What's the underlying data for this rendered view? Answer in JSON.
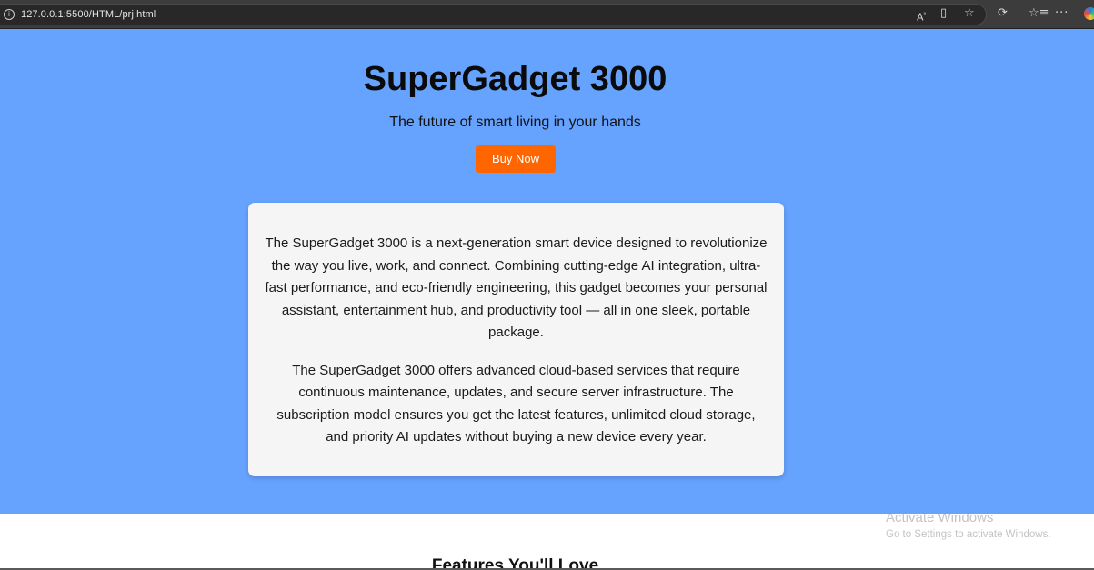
{
  "browser": {
    "url": "127.0.0.1:5500/HTML/prj.html",
    "icons": {
      "site_info": "info-icon",
      "read_aloud": "read-aloud-icon",
      "immersive_reader": "immersive-reader-icon",
      "favorite": "star-icon",
      "extensions": "extensions-icon",
      "favorites": "favorites-icon",
      "more": "more-icon",
      "copilot": "copilot-icon"
    }
  },
  "hero": {
    "title": "SuperGadget 3000",
    "subtitle": "The future of smart living in your hands",
    "buy_label": "Buy Now",
    "background_color": "#66a3ff",
    "button_color": "#ff6600"
  },
  "card": {
    "paragraph_1": "The SuperGadget 3000 is a next-generation smart device designed to revolutionize the way you live, work, and connect. Combining cutting-edge AI integration, ultra-fast performance, and eco-friendly engineering, this gadget becomes your personal assistant, entertainment hub, and productivity tool — all in one sleek, portable package.",
    "paragraph_2": "The SuperGadget 3000 offers advanced cloud-based services that require continuous maintenance, updates, and secure server infrastructure. The subscription model ensures you get the latest features, unlimited cloud storage, and priority AI updates without buying a new device every year."
  },
  "features": {
    "heading": "Features You'll Love"
  },
  "watermark": {
    "title": "Activate Windows",
    "subtitle": "Go to Settings to activate Windows."
  }
}
